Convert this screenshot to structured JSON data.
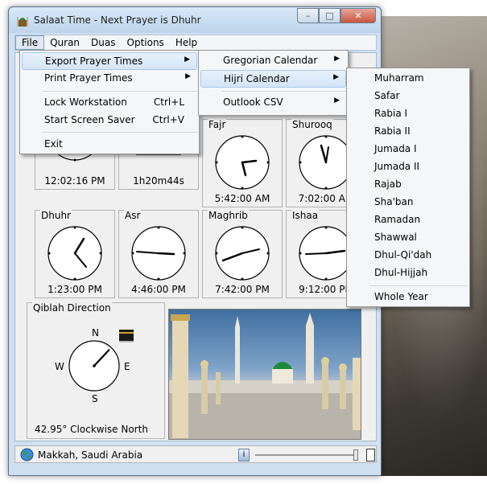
{
  "window": {
    "title": "Salaat Time - Next Prayer is Dhuhr",
    "controls": {
      "minimize": "–",
      "maximize": "□",
      "close": "✕"
    }
  },
  "menubar": [
    "File",
    "Quran",
    "Duas",
    "Options",
    "Help"
  ],
  "file_menu": {
    "items": [
      {
        "label": "Export Prayer Times",
        "has_submenu": true
      },
      {
        "label": "Print Prayer Times",
        "has_submenu": true
      },
      {
        "label": "Lock Workstation",
        "shortcut": "Ctrl+L"
      },
      {
        "label": "Start Screen Saver",
        "shortcut": "Ctrl+V"
      },
      {
        "label": "Exit"
      }
    ]
  },
  "export_menu": {
    "items": [
      {
        "label": "Gregorian Calendar",
        "has_submenu": true
      },
      {
        "label": "Hijri Calendar",
        "has_submenu": true
      },
      {
        "label": "Outlook CSV",
        "has_submenu": true
      }
    ]
  },
  "hijri_menu": {
    "items": [
      "Muharram",
      "Safar",
      "Rabia I",
      "Rabia II",
      "Jumada I",
      "Jumada II",
      "Rajab",
      "Sha'ban",
      "Ramadan",
      "Shawwal",
      "Dhul-Qi'dah",
      "Dhul-Hijjah"
    ],
    "whole_year": "Whole Year"
  },
  "clocks": {
    "current": {
      "time": "12:02:16 PM"
    },
    "countdown": {
      "time": "1h20m44s",
      "fill_fraction": 0.33
    },
    "fajr": {
      "name": "Fajr",
      "time": "5:42:00 AM"
    },
    "shurooq": {
      "name": "Shurooq",
      "time": "7:02:00 AM"
    },
    "dhuhr": {
      "name": "Dhuhr",
      "time": "1:23:00 PM"
    },
    "asr": {
      "name": "Asr",
      "time": "4:46:00 PM"
    },
    "maghrib": {
      "name": "Maghrib",
      "time": "7:42:00 PM"
    },
    "ishaa": {
      "name": "Ishaa",
      "time": "9:12:00 PM"
    }
  },
  "qiblah": {
    "title": "Qiblah Direction",
    "compass": {
      "n": "N",
      "s": "S",
      "e": "E",
      "w": "W"
    },
    "bearing_deg": 42.95,
    "direction_text": "42.95° Clockwise North"
  },
  "status": {
    "location": "Makkah, Saudi Arabia"
  },
  "colors": {
    "countdown_fill": "#3d7fd6",
    "dome": "#1f8a3e"
  }
}
